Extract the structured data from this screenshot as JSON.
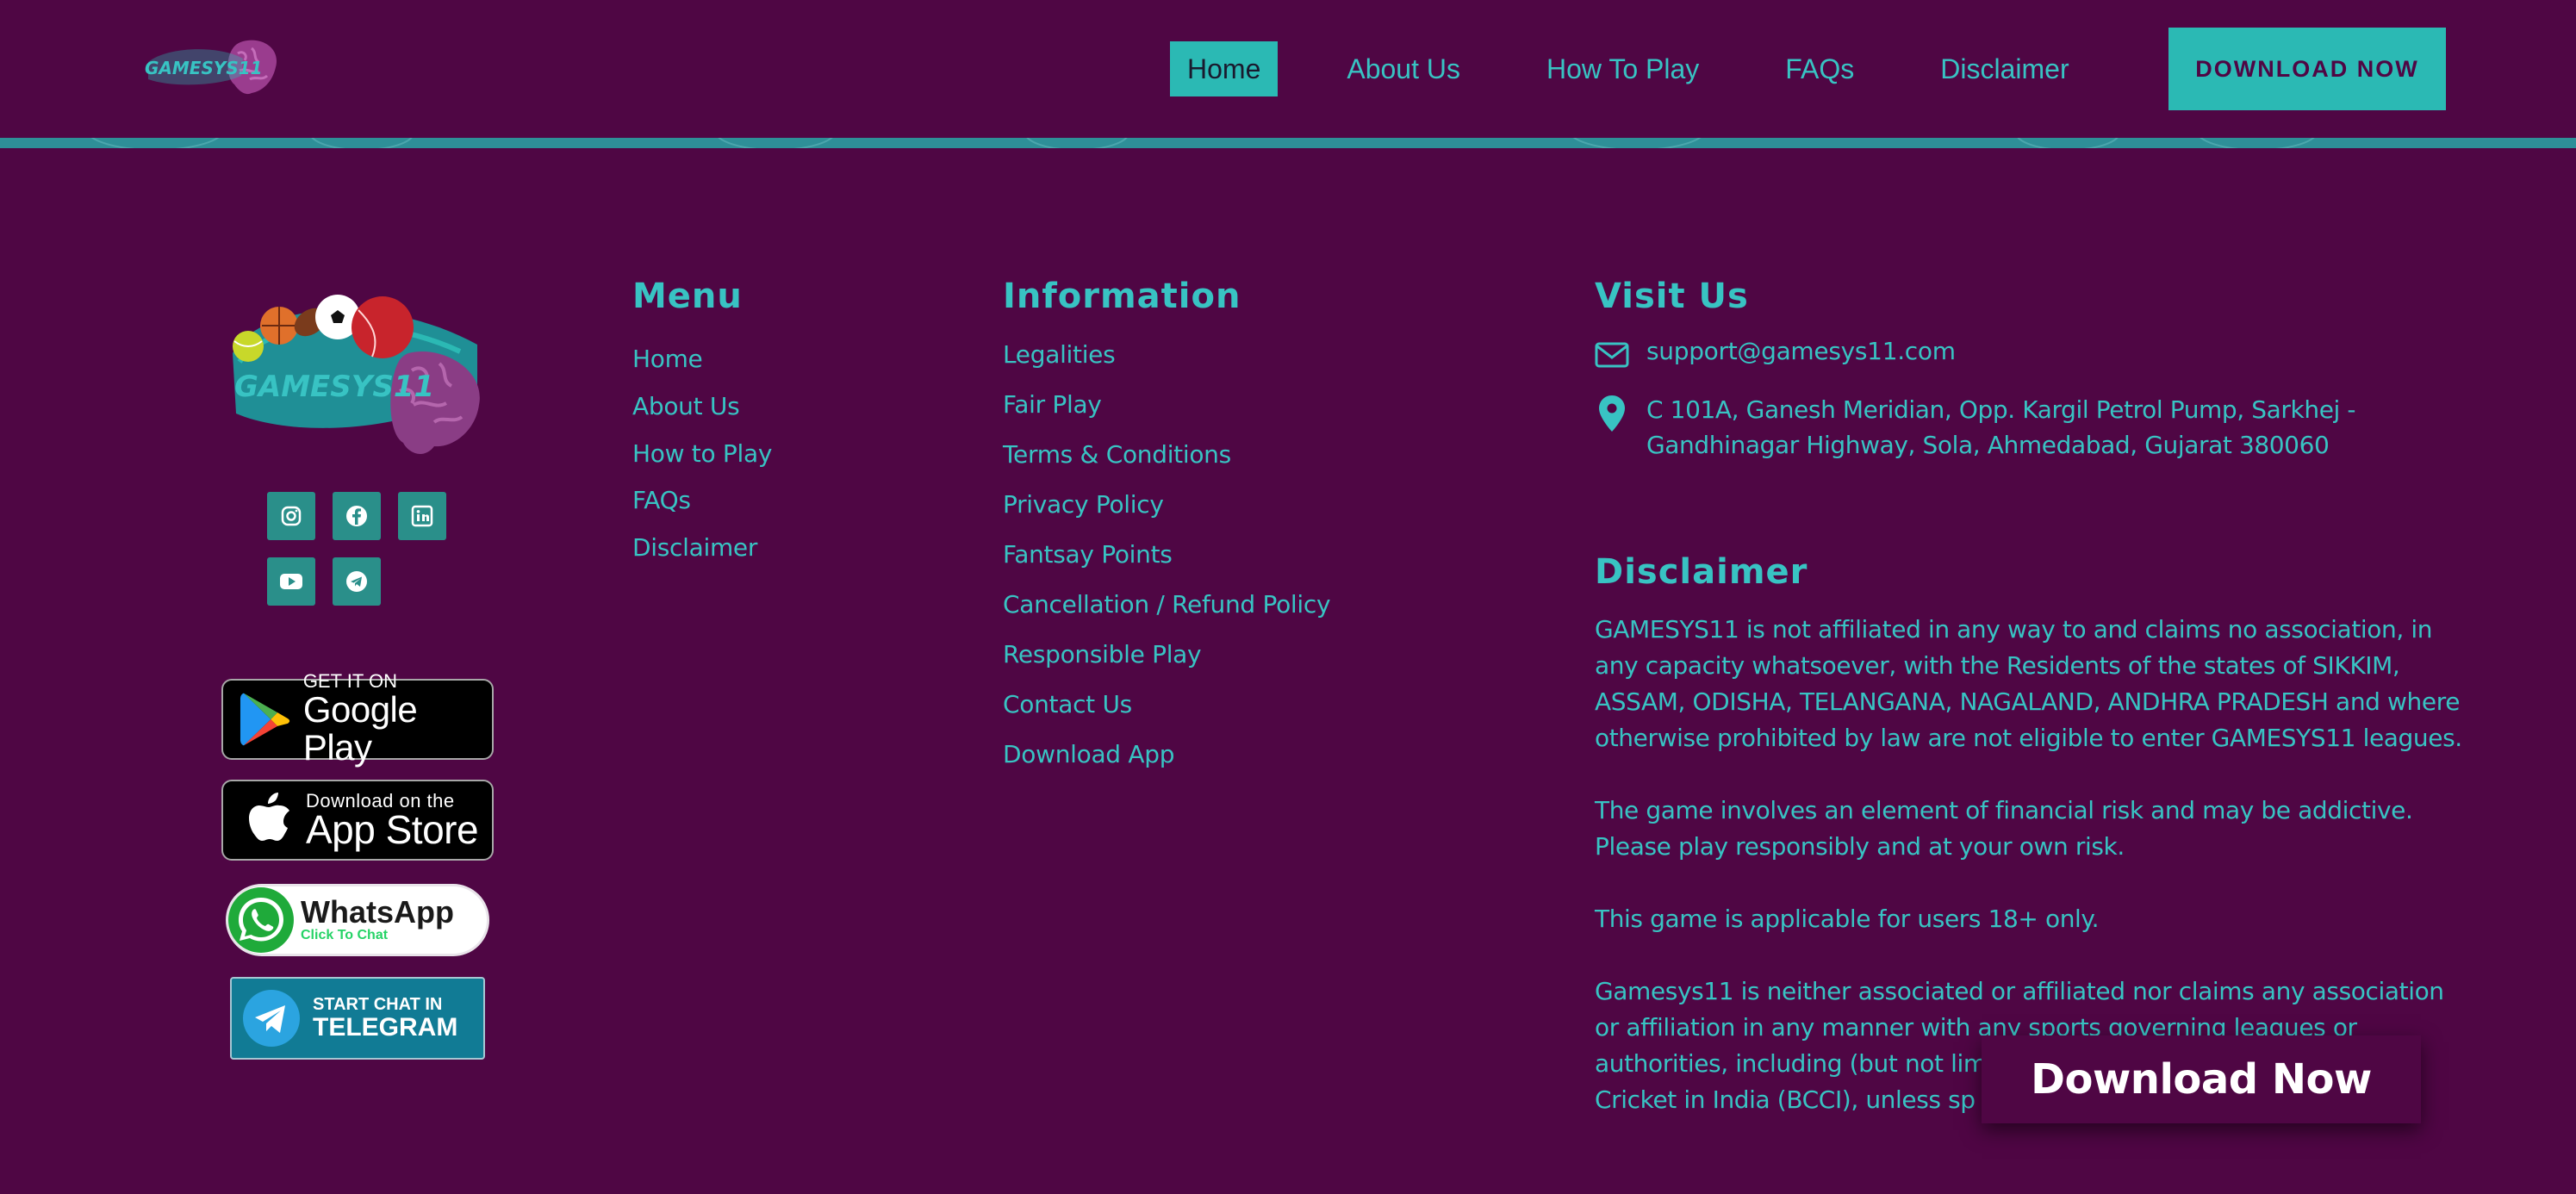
{
  "header": {
    "logo_text": "GAMESYS11",
    "nav": [
      {
        "label": "Home",
        "active": true
      },
      {
        "label": "About Us",
        "active": false
      },
      {
        "label": "How To Play",
        "active": false
      },
      {
        "label": "FAQs",
        "active": false
      },
      {
        "label": "Disclaimer",
        "active": false
      }
    ],
    "download_label": "DOWNLOAD NOW"
  },
  "brand": {
    "logo_text": "GAMESYS11",
    "social": [
      {
        "icon": "instagram-icon"
      },
      {
        "icon": "facebook-icon"
      },
      {
        "icon": "linkedin-icon"
      },
      {
        "icon": "youtube-icon"
      },
      {
        "icon": "telegram-icon"
      }
    ],
    "google_play": {
      "sub": "GET IT ON",
      "main": "Google Play"
    },
    "app_store": {
      "sub": "Download on the",
      "main": "App Store"
    },
    "whatsapp": {
      "main": "WhatsApp",
      "sub": "Click To Chat"
    },
    "telegram": {
      "sub": "START CHAT IN",
      "main": "TELEGRAM"
    }
  },
  "menu": {
    "title": "Menu",
    "items": [
      "Home",
      "About Us",
      "How to Play",
      "FAQs",
      "Disclaimer"
    ]
  },
  "information": {
    "title": "Information",
    "items": [
      "Legalities",
      "Fair Play",
      "Terms & Conditions",
      "Privacy Policy",
      "Fantsay Points",
      "Cancellation / Refund Policy",
      "Responsible Play",
      "Contact Us",
      "Download App"
    ]
  },
  "visit": {
    "title": "Visit Us",
    "email": "support@gamesys11.com",
    "address_line1": "C 101A, Ganesh Meridian, Opp. Kargil Petrol Pump, Sarkhej -",
    "address_line2": "Gandhinagar Highway, Sola, Ahmedabad, Gujarat 380060"
  },
  "disclaimer": {
    "title": "Disclaimer",
    "p1_lines": [
      "GAMESYS11 is not affiliated in any way to and claims no association, in",
      "any capacity whatsoever, with the Residents of the states of SIKKIM,",
      "ASSAM, ODISHA, TELANGANA, NAGALAND, ANDHRA PRADESH and where",
      "otherwise prohibited by law are not eligible to enter GAMESYS11 leagues."
    ],
    "p2_lines": [
      "The game involves an element of financial risk and may be addictive.",
      "Please play responsibly and at your own risk."
    ],
    "p3_lines": [
      "This game is applicable for users 18+ only."
    ],
    "p4_lines": [
      "Gamesys11 is neither associated or affiliated nor claims any association",
      "or affiliation in any manner with any sports governing leagues or",
      "authorities, including (but not lim",
      "Cricket in India (BCCI), unless sp"
    ]
  },
  "floating": {
    "download_label": "Download Now"
  },
  "colors": {
    "background": "#4f0644",
    "accent": "#2bb9b4",
    "text": "#38c3c3"
  }
}
